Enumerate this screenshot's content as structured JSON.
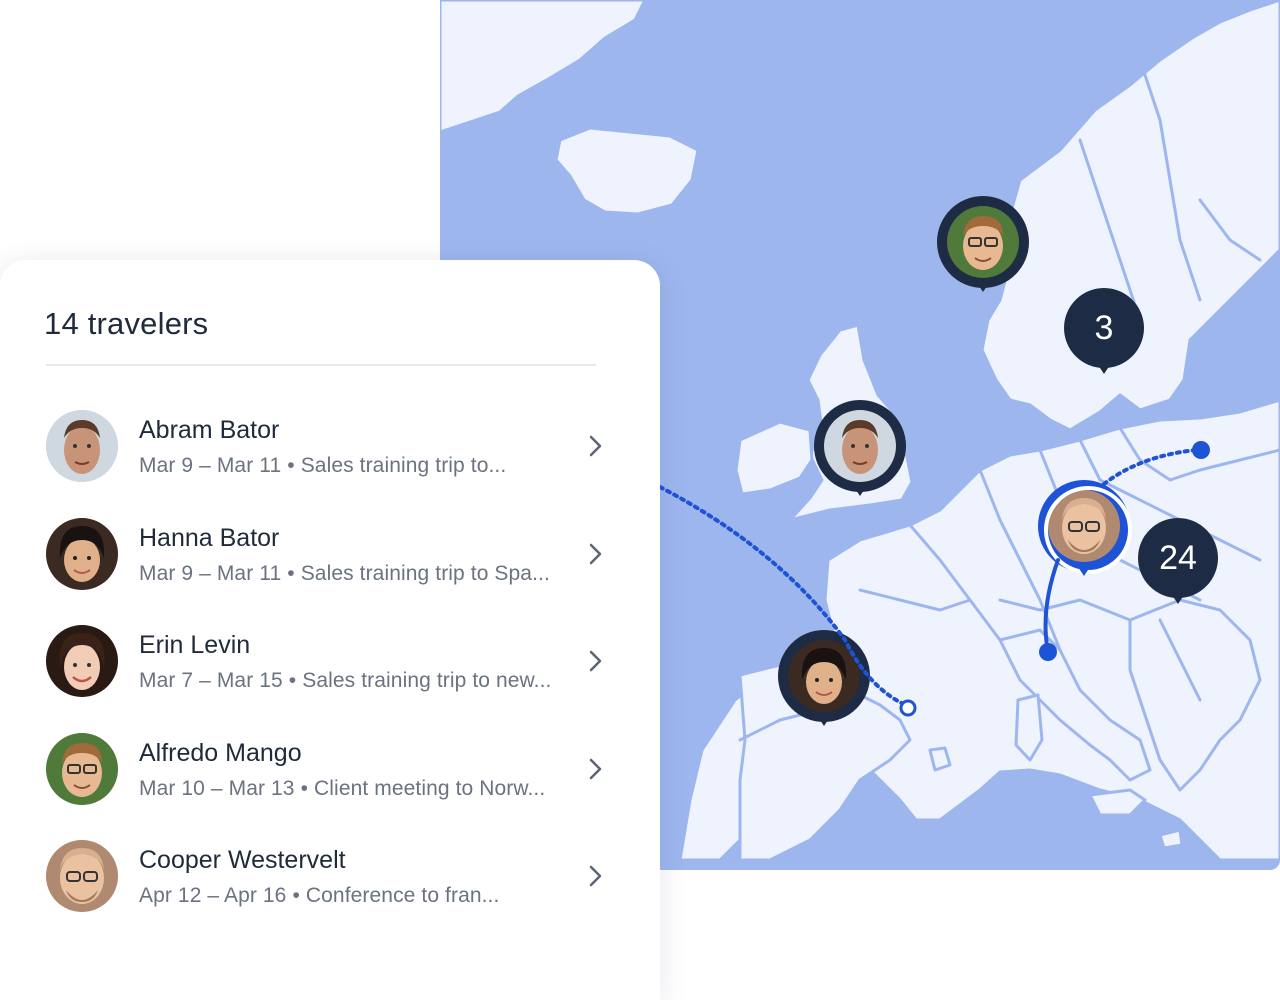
{
  "panel": {
    "title": "14 travelers",
    "travelers": [
      {
        "name": "Abram Bator",
        "dates": "Mar 9 – Mar 11",
        "trip": "Sales training trip to..."
      },
      {
        "name": "Hanna Bator",
        "dates": "Mar 9 – Mar 11",
        "trip": "Sales training trip to Spa..."
      },
      {
        "name": "Erin Levin",
        "dates": "Mar 7 – Mar 15",
        "trip": "Sales training trip to new..."
      },
      {
        "name": "Alfredo Mango",
        "dates": "Mar 10 – Mar 13",
        "trip": "Client meeting to Norw..."
      },
      {
        "name": "Cooper Westervelt",
        "dates": "Apr 12 – Apr 16",
        "trip": "Conference to fran..."
      }
    ]
  },
  "map": {
    "clusters": [
      {
        "count": "3"
      },
      {
        "count": "24"
      }
    ],
    "colors": {
      "water": "#9db7ee",
      "land": "#eef3fd",
      "marker": "#1d2b45",
      "active": "#1f53d6"
    }
  },
  "icons": {
    "row_action": "chevron-right-icon"
  }
}
